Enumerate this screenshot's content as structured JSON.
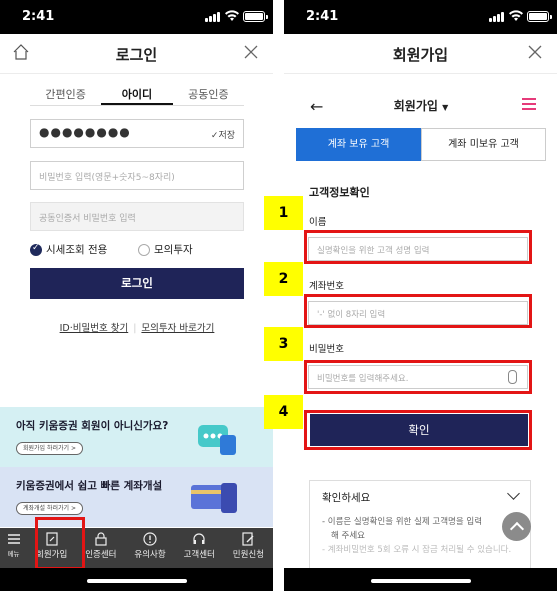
{
  "left": {
    "status_time": "2:41",
    "header_title": "로그인",
    "tabs": [
      "간편인증",
      "아이디",
      "공동인증"
    ],
    "id_value": "●●●●●●●●",
    "save_label": "저장",
    "password_placeholder": "비밀번호 입력(영문+숫자5~8자리)",
    "cert_password_placeholder": "공동인증서 비밀번호 입력",
    "radio_1": "시세조회 전용",
    "radio_2": "모의투자",
    "login_button": "로그인",
    "link_1": "ID·비밀번호 찾기",
    "link_2": "모의투자 바로가기",
    "banner_1_text": "아직 키움증권 회원이 아니신가요?",
    "banner_1_button": "회원가입 하러가기 >",
    "banner_2_text": "키움증권에서 쉽고 빠른 계좌개설",
    "banner_2_button": "계좌개설 하러가기 >",
    "nav": [
      "메뉴",
      "회원가입",
      "인증센터",
      "유의사항",
      "고객센터",
      "민원신청"
    ]
  },
  "right": {
    "status_time": "2:41",
    "header_title": "회원가입",
    "sub_title": "회원가입",
    "seg_1": "계좌 보유 고객",
    "seg_2": "계좌 미보유 고객",
    "section_title": "고객정보확인",
    "name_label": "이름",
    "name_placeholder": "실명확인을 위한 고객 성명 입력",
    "account_label": "계좌번호",
    "account_placeholder": "'-' 없이 8자리 입력",
    "password_label": "비밀번호",
    "password_placeholder": "비밀번호를 입력해주세요.",
    "confirm_button": "확인",
    "info_title": "확인하세요",
    "info_line_1": "- 이름은 실명확인을 위한 실제 고객명을 입력",
    "info_line_2": "해 주세요",
    "info_line_3": "- 계좌비밀번호 5회 오류 시 잠금 처리될 수 있습니다."
  },
  "steps": [
    "1",
    "2",
    "3",
    "4"
  ],
  "colors": {
    "navy": "#1f2458",
    "blue_tab": "#1f6fd6",
    "highlight": "#e31515",
    "badge": "#ffff00"
  }
}
